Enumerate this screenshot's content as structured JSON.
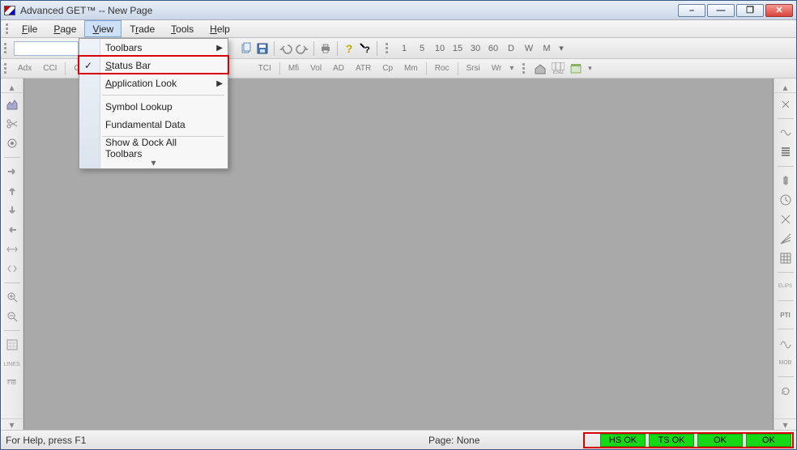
{
  "title": "Advanced GET™  --  New Page",
  "menubar": {
    "file": "File",
    "page": "Page",
    "view": "View",
    "trade": "Trade",
    "tools": "Tools",
    "help": "Help"
  },
  "view_menu": {
    "toolbars": "Toolbars",
    "statusbar": "Status Bar",
    "applook": "Application Look",
    "symbol_lookup": "Symbol Lookup",
    "fundamental": "Fundamental Data",
    "show_dock": "Show & Dock All Toolbars"
  },
  "time_buttons": [
    "1",
    "5",
    "10",
    "15",
    "30",
    "60",
    "D",
    "W",
    "M"
  ],
  "studies": [
    "Adx",
    "CCI",
    "Cyc",
    "TCI",
    "Mfi",
    "Vol",
    "AD",
    "ATR",
    "Cp",
    "Mm",
    "Roc",
    "Srsi",
    "Wr"
  ],
  "right_tools": [
    "PTI",
    "MOB"
  ],
  "status": {
    "help": "For Help, press F1",
    "page": "Page: None",
    "hs": "HS OK",
    "ts": "TS OK",
    "ok1": "OK",
    "ok2": "OK"
  },
  "esiz_label": "ESIZ"
}
